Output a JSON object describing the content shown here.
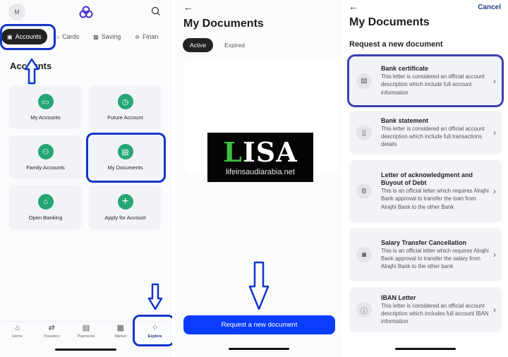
{
  "screen1": {
    "avatar_initial": "M",
    "brand_icon": "alrajhi-logo-icon",
    "category_tabs": [
      {
        "label": "Accounts",
        "icon": "wallet-icon",
        "active": true
      },
      {
        "label": "Cards",
        "icon": "card-icon",
        "active": false
      },
      {
        "label": "Saving",
        "icon": "saving-icon",
        "active": false
      },
      {
        "label": "Finan",
        "icon": "finance-icon",
        "active": false
      }
    ],
    "section_title": "Accounts",
    "tiles": [
      {
        "label": "My Accounts",
        "icon": "account-card-icon",
        "glyph": "▭"
      },
      {
        "label": "Future Account",
        "icon": "future-clock-icon",
        "glyph": "◷"
      },
      {
        "label": "Family Accounts",
        "icon": "family-icon",
        "glyph": "⚇"
      },
      {
        "label": "My Documents",
        "icon": "document-icon",
        "glyph": "▤"
      },
      {
        "label": "Open Banking",
        "icon": "bank-icon",
        "glyph": "⌂"
      },
      {
        "label": "Apply for Account",
        "icon": "plus-icon",
        "glyph": "+"
      }
    ],
    "bottom_nav": [
      {
        "label": "Home",
        "icon": "home-icon",
        "glyph": "⌂",
        "active": false
      },
      {
        "label": "Transfers",
        "icon": "transfers-icon",
        "glyph": "⇄",
        "active": false
      },
      {
        "label": "Payments",
        "icon": "payments-icon",
        "glyph": "▤",
        "active": false
      },
      {
        "label": "Market",
        "icon": "market-icon",
        "glyph": "▦",
        "active": false
      },
      {
        "label": "Explore",
        "icon": "explore-icon",
        "glyph": "⁘",
        "active": true
      }
    ]
  },
  "screen2": {
    "title": "My Documents",
    "tabs": [
      {
        "label": "Active",
        "active": true
      },
      {
        "label": "Expired",
        "active": false
      }
    ],
    "watermark": {
      "big_green": "L",
      "big_white": "ISA",
      "site": "lifeinsaudiarabia.net"
    },
    "request_button": "Request a new document"
  },
  "screen3": {
    "title": "My Documents",
    "cancel_label": "Cancel",
    "subtitle": "Request a new document",
    "documents": [
      {
        "title": "Bank certificate",
        "description": "This letter is considered an official account description which include full account information",
        "icon": "certificate-icon",
        "glyph": "▤",
        "selected": true
      },
      {
        "title": "Bank statement",
        "description": "This letter is considered an official account description which include full transactions details",
        "icon": "statement-icon",
        "glyph": "▯",
        "selected": false
      },
      {
        "title": "Letter of acknowledgment and Buyout of Debt",
        "description": "This is an official letter which requires Alrajhi Bank approval to transfer the loan from Alrajhi Bank to the other Bank",
        "icon": "debt-letter-icon",
        "glyph": "B",
        "selected": false
      },
      {
        "title": "Salary Transfer Cancellation",
        "description": "This is an official letter which requires Alrajhi Bank approval to transfer the salary from Alrajhi Bank to the other bank",
        "icon": "salary-cancel-icon",
        "glyph": "◙",
        "selected": false
      },
      {
        "title": "IBAN Letter",
        "description": "This letter is considered an official account description which includes full account IBAN information",
        "icon": "iban-letter-icon",
        "glyph": "ⓘ",
        "selected": false
      }
    ]
  },
  "colors": {
    "accent_green": "#24a675",
    "primary_blue": "#0a3dff",
    "highlight_blue": "#1036c8",
    "dark_pill": "#222222"
  }
}
